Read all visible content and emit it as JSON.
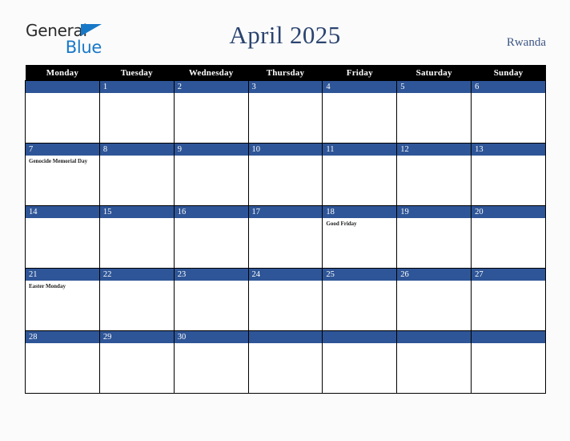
{
  "brand": {
    "line1": "General",
    "line2": "Blue",
    "triangle_color": "#1878c8",
    "text_color": "#2b2b2b"
  },
  "header": {
    "title": "April 2025",
    "region": "Rwanda",
    "title_color": "#2b4470",
    "region_color": "#3c5584"
  },
  "calendar": {
    "weekday_headers": [
      "Monday",
      "Tuesday",
      "Wednesday",
      "Thursday",
      "Friday",
      "Saturday",
      "Sunday"
    ],
    "header_bg": "#000000",
    "header_text": "#ffffff",
    "daynum_bg": "#2e5597",
    "daynum_text": "#ffffff",
    "cell_bg": "#ffffff",
    "grid_line": "#000000",
    "weeks": [
      [
        {
          "day": "",
          "events": []
        },
        {
          "day": "1",
          "events": []
        },
        {
          "day": "2",
          "events": []
        },
        {
          "day": "3",
          "events": []
        },
        {
          "day": "4",
          "events": []
        },
        {
          "day": "5",
          "events": []
        },
        {
          "day": "6",
          "events": []
        }
      ],
      [
        {
          "day": "7",
          "events": [
            "Genocide Memorial Day"
          ]
        },
        {
          "day": "8",
          "events": []
        },
        {
          "day": "9",
          "events": []
        },
        {
          "day": "10",
          "events": []
        },
        {
          "day": "11",
          "events": []
        },
        {
          "day": "12",
          "events": []
        },
        {
          "day": "13",
          "events": []
        }
      ],
      [
        {
          "day": "14",
          "events": []
        },
        {
          "day": "15",
          "events": []
        },
        {
          "day": "16",
          "events": []
        },
        {
          "day": "17",
          "events": []
        },
        {
          "day": "18",
          "events": [
            "Good Friday"
          ]
        },
        {
          "day": "19",
          "events": []
        },
        {
          "day": "20",
          "events": []
        }
      ],
      [
        {
          "day": "21",
          "events": [
            "Easter Monday"
          ]
        },
        {
          "day": "22",
          "events": []
        },
        {
          "day": "23",
          "events": []
        },
        {
          "day": "24",
          "events": []
        },
        {
          "day": "25",
          "events": []
        },
        {
          "day": "26",
          "events": []
        },
        {
          "day": "27",
          "events": []
        }
      ],
      [
        {
          "day": "28",
          "events": []
        },
        {
          "day": "29",
          "events": []
        },
        {
          "day": "30",
          "events": []
        },
        {
          "day": "",
          "events": []
        },
        {
          "day": "",
          "events": []
        },
        {
          "day": "",
          "events": []
        },
        {
          "day": "",
          "events": []
        }
      ]
    ]
  }
}
